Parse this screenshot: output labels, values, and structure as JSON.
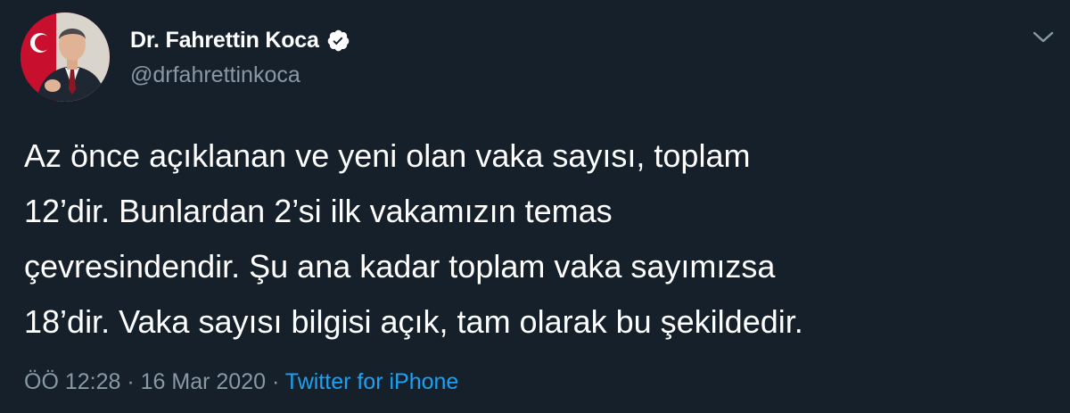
{
  "tweet": {
    "author": {
      "display_name": "Dr. Fahrettin Koca",
      "handle": "@drfahrettinkoca",
      "verified": true
    },
    "text_lines": [
      "Az önce açıklanan ve yeni olan vaka sayısı, toplam",
      "12’dir. Bunlardan 2’si ilk vakamızın temas",
      "çevresindendir. Şu ana kadar toplam vaka sayımızsa",
      "18’dir. Vaka sayısı bilgisi açık, tam olarak bu şekildedir."
    ],
    "time": "ÖÖ 12:28",
    "separator": "·",
    "date": "16 Mar 2020",
    "source": "Twitter for iPhone"
  },
  "icons": {
    "verified": "verified-badge-icon",
    "menu": "chevron-down-icon"
  },
  "colors": {
    "background": "#15202b",
    "text_primary": "#ffffff",
    "text_secondary": "#8899a6",
    "link": "#1da1f2"
  }
}
